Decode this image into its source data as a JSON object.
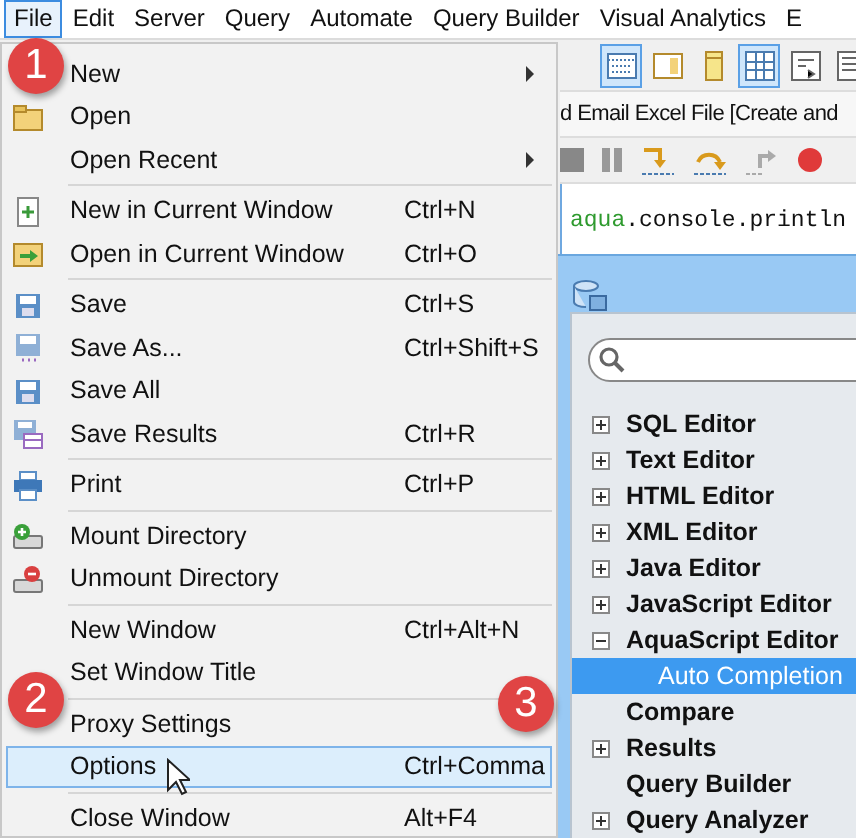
{
  "menubar": [
    {
      "label": "File",
      "selected": true
    },
    {
      "label": "Edit",
      "selected": false
    },
    {
      "label": "Server",
      "selected": false
    },
    {
      "label": "Query",
      "selected": false
    },
    {
      "label": "Automate",
      "selected": false
    },
    {
      "label": "Query Builder",
      "selected": false
    },
    {
      "label": "Visual Analytics",
      "selected": false
    },
    {
      "label": "E",
      "selected": false
    }
  ],
  "toolbar": [
    {
      "selected": true
    },
    {
      "selected": false
    },
    {
      "selected": false
    },
    {
      "selected": true
    },
    {
      "selected": false
    },
    {
      "selected": false
    }
  ],
  "editor_tab": {
    "title": "d Email Excel File [Create and"
  },
  "code": [
    {
      "kind": "identifier",
      "text": "aqua"
    },
    {
      "kind": "plain",
      "text": ".console.println"
    }
  ],
  "file_menu": [
    {
      "kind": "item",
      "label": "New",
      "submenu": true,
      "selected": false
    },
    {
      "kind": "item",
      "label": "Open",
      "selected": false
    },
    {
      "kind": "item",
      "label": "Open Recent",
      "submenu": true,
      "selected": false
    },
    {
      "kind": "separator"
    },
    {
      "kind": "item",
      "label": "New in Current Window",
      "shortcut": "Ctrl+N",
      "selected": false
    },
    {
      "kind": "item",
      "label": "Open in Current Window",
      "shortcut": "Ctrl+O",
      "selected": false
    },
    {
      "kind": "separator"
    },
    {
      "kind": "item",
      "label": "Save",
      "shortcut": "Ctrl+S",
      "selected": false
    },
    {
      "kind": "item",
      "label": "Save As...",
      "shortcut": "Ctrl+Shift+S",
      "selected": false
    },
    {
      "kind": "item",
      "label": "Save All",
      "selected": false
    },
    {
      "kind": "item",
      "label": "Save Results",
      "shortcut": "Ctrl+R",
      "selected": false
    },
    {
      "kind": "separator"
    },
    {
      "kind": "item",
      "label": "Print",
      "shortcut": "Ctrl+P",
      "selected": false
    },
    {
      "kind": "separator"
    },
    {
      "kind": "item",
      "label": "Mount Directory",
      "selected": false
    },
    {
      "kind": "item",
      "label": "Unmount Directory",
      "selected": false
    },
    {
      "kind": "separator"
    },
    {
      "kind": "item",
      "label": "New Window",
      "shortcut": "Ctrl+Alt+N",
      "selected": false
    },
    {
      "kind": "item",
      "label": "Set Window Title",
      "selected": false
    },
    {
      "kind": "separator"
    },
    {
      "kind": "item",
      "label": "Proxy Settings",
      "selected": false
    },
    {
      "kind": "item",
      "label": "Options",
      "shortcut": "Ctrl+Comma",
      "selected": true
    },
    {
      "kind": "separator"
    },
    {
      "kind": "item",
      "label": "Close Window",
      "shortcut": "Alt+F4",
      "selected": false
    }
  ],
  "options_dialog": {
    "tree": [
      {
        "label": "SQL Editor",
        "expanded": false,
        "selected": false
      },
      {
        "label": "Text Editor",
        "expanded": false,
        "selected": false
      },
      {
        "label": "HTML Editor",
        "expanded": false,
        "selected": false
      },
      {
        "label": "XML Editor",
        "expanded": false,
        "selected": false
      },
      {
        "label": "Java Editor",
        "expanded": false,
        "selected": false
      },
      {
        "label": "JavaScript Editor",
        "expanded": false,
        "selected": false
      },
      {
        "label": "AquaScript Editor",
        "expanded": true,
        "selected": false,
        "children": [
          {
            "label": "Auto Completion",
            "selected": true
          }
        ]
      },
      {
        "label": "Compare",
        "selected": false
      },
      {
        "label": "Results",
        "expanded": false,
        "selected": false
      },
      {
        "label": "Query Builder",
        "selected": false
      },
      {
        "label": "Query Analyzer",
        "expanded": false,
        "selected": false
      }
    ]
  },
  "callouts": [
    {
      "label": "1"
    },
    {
      "label": "2"
    },
    {
      "label": "3"
    }
  ]
}
